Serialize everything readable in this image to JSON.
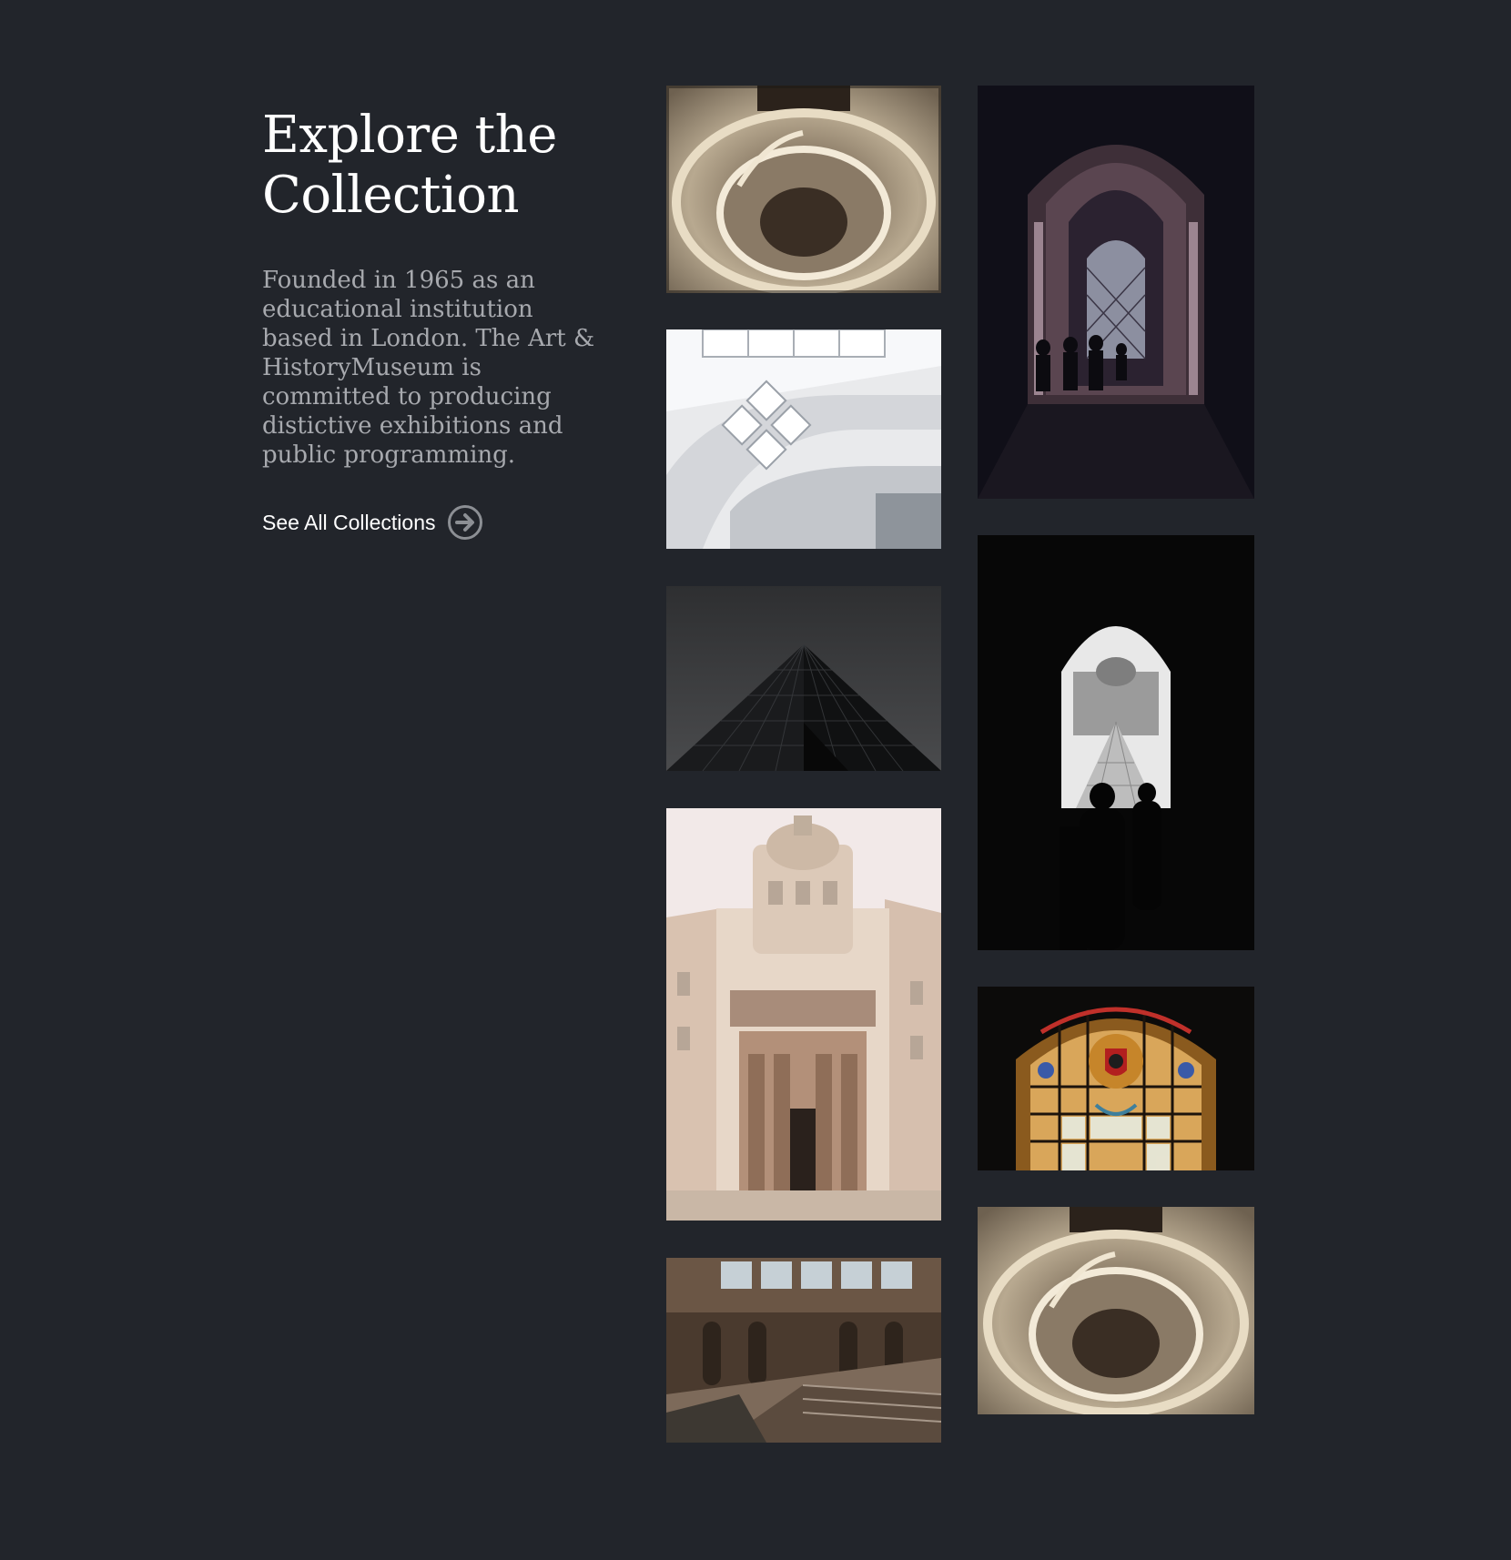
{
  "page": {
    "background": "#22252b"
  },
  "intro": {
    "title_line1": "Explore the",
    "title_line2": "Collection",
    "description": "Founded in 1965 as an educational institution based in London. The Art & HistoryMuseum is committed to producing distictive exhibitions and public programming.",
    "cta_label": "See All Collections",
    "cta_icon": "arrow-right-circle-icon"
  },
  "gallery": {
    "left_column": [
      "spiral-staircase-photo",
      "skylight-atrium-photo",
      "glass-pyramid-photo",
      "ornate-building-facade-photo",
      "museum-great-hall-photo"
    ],
    "right_column": [
      "arched-corridor-photo",
      "arch-silhouette-pyramid-photo",
      "stained-glass-window-photo",
      "spiral-staircase-photo-2"
    ]
  }
}
